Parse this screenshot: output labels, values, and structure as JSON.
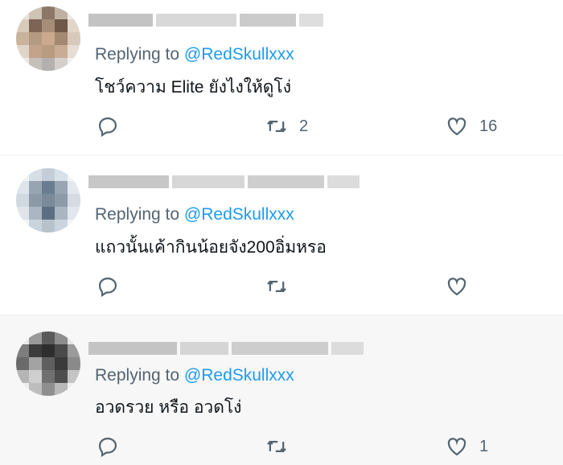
{
  "tweets": [
    {
      "replying_prefix": "Replying to ",
      "mention": "@RedSkullxxx",
      "text": "โชว์ความ Elite ยังไงให้ดูโง่",
      "retweet_count": "2",
      "like_count": "16"
    },
    {
      "replying_prefix": "Replying to ",
      "mention": "@RedSkullxxx",
      "text": "แถวนั้นเค้ากินน้อยจัง200อิ่มหรอ",
      "retweet_count": "",
      "like_count": ""
    },
    {
      "replying_prefix": "Replying to ",
      "mention": "@RedSkullxxx",
      "text": "อวดรวย หรือ อวดโง่",
      "retweet_count": "",
      "like_count": "1"
    }
  ],
  "colors": {
    "mention": "#1d9bf0",
    "secondary_text": "#536471",
    "primary_text": "#0f1419",
    "highlight_row": "#f7f7f7"
  },
  "icons": [
    "reply-icon",
    "retweet-icon",
    "like-icon"
  ]
}
